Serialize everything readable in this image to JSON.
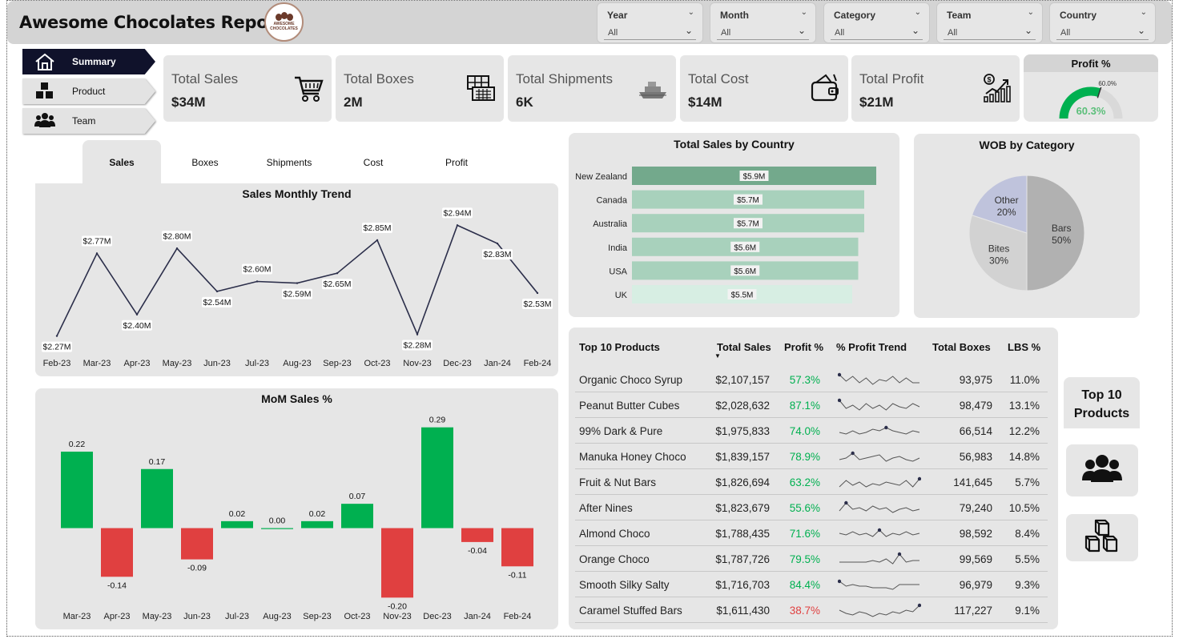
{
  "report": {
    "title": "Awesome Chocolates Report",
    "logo_text": "AWESOME CHOCOLATES"
  },
  "slicers": [
    {
      "label": "Year",
      "value": "All"
    },
    {
      "label": "Month",
      "value": "All"
    },
    {
      "label": "Category",
      "value": "All"
    },
    {
      "label": "Team",
      "value": "All"
    },
    {
      "label": "Country",
      "value": "All"
    }
  ],
  "nav": [
    {
      "label": "Summary",
      "icon": "home-icon",
      "active": true
    },
    {
      "label": "Product",
      "icon": "boxes-icon",
      "active": false
    },
    {
      "label": "Team",
      "icon": "team-icon",
      "active": false
    }
  ],
  "kpis": [
    {
      "title": "Total Sales",
      "value": "$34M",
      "icon": "shopping-cart-icon"
    },
    {
      "title": "Total Boxes",
      "value": "2M",
      "icon": "box-icon"
    },
    {
      "title": "Total Shipments",
      "value": "6K",
      "icon": "ship-icon"
    },
    {
      "title": "Total Cost",
      "value": "$14M",
      "icon": "wallet-icon"
    },
    {
      "title": "Total Profit",
      "value": "$21M",
      "icon": "profit-growth-icon"
    }
  ],
  "profit_gauge": {
    "title": "Profit %",
    "value": 60.3,
    "value_label": "60.3%",
    "target": 60.0,
    "target_label": "60.0%",
    "color": "#00b050"
  },
  "tabs": [
    {
      "label": "Sales",
      "active": true
    },
    {
      "label": "Boxes",
      "active": false
    },
    {
      "label": "Shipments",
      "active": false
    },
    {
      "label": "Cost",
      "active": false
    },
    {
      "label": "Profit",
      "active": false
    }
  ],
  "colors": {
    "positive": "#00b050",
    "negative": "#e04040",
    "line": "#2b2e4a",
    "bar_top": "#73a98c",
    "bar_mid": "#a8d1bc",
    "bar_light": "#d7eee3"
  },
  "chart_data": [
    {
      "id": "sales-monthly-trend",
      "type": "line",
      "title": "Sales Monthly Trend",
      "x": [
        "Feb-23",
        "Mar-23",
        "Apr-23",
        "May-23",
        "Jun-23",
        "Jul-23",
        "Aug-23",
        "Sep-23",
        "Oct-23",
        "Nov-23",
        "Dec-23",
        "Jan-24",
        "Feb-24"
      ],
      "values": [
        2.27,
        2.77,
        2.4,
        2.8,
        2.54,
        2.6,
        2.59,
        2.65,
        2.85,
        2.28,
        2.94,
        2.83,
        2.53
      ],
      "labels": [
        "$2.27M",
        "$2.77M",
        "$2.40M",
        "$2.80M",
        "$2.54M",
        "$2.60M",
        "$2.59M",
        "$2.65M",
        "$2.85M",
        "$2.28M",
        "$2.94M",
        "$2.83M",
        "$2.53M"
      ],
      "ylim": [
        2.2,
        3.0
      ]
    },
    {
      "id": "mom-sales",
      "type": "bar",
      "title": "MoM Sales %",
      "categories": [
        "Mar-23",
        "Apr-23",
        "May-23",
        "Jun-23",
        "Jul-23",
        "Aug-23",
        "Sep-23",
        "Oct-23",
        "Nov-23",
        "Dec-23",
        "Jan-24",
        "Feb-24"
      ],
      "values": [
        0.22,
        -0.14,
        0.17,
        -0.09,
        0.02,
        0.0,
        0.02,
        0.07,
        -0.2,
        0.29,
        -0.04,
        -0.11
      ],
      "labels": [
        "0.22",
        "-0.14",
        "0.17",
        "-0.09",
        "0.02",
        "0.00",
        "0.02",
        "0.07",
        "-0.20",
        "0.29",
        "-0.04",
        "-0.11"
      ],
      "ylim": [
        -0.22,
        0.31
      ]
    },
    {
      "id": "sales-by-country",
      "type": "bar",
      "orientation": "horizontal",
      "title": "Total Sales by Country",
      "categories": [
        "New Zealand",
        "Canada",
        "Australia",
        "India",
        "USA",
        "UK"
      ],
      "values": [
        5.9,
        5.7,
        5.7,
        5.6,
        5.6,
        5.5
      ],
      "labels": [
        "$5.9M",
        "$5.7M",
        "$5.7M",
        "$5.6M",
        "$5.6M",
        "$5.5M"
      ]
    },
    {
      "id": "wob-by-category",
      "type": "pie",
      "title": "WOB by Category",
      "categories": [
        "Bars",
        "Bites",
        "Other"
      ],
      "values": [
        50,
        30,
        20
      ],
      "labels": [
        "50%",
        "30%",
        "20%"
      ],
      "colors": [
        "#b1b1b1",
        "#d2d2d2",
        "#bfc3dc"
      ]
    }
  ],
  "top_products": {
    "headers": [
      "Top 10 Products",
      "Total Sales",
      "Profit %",
      "% Profit Trend",
      "Total Boxes",
      "LBS %"
    ],
    "rows": [
      {
        "product": "Organic Choco Syrup",
        "sales": "$2,107,157",
        "profit": "57.3%",
        "boxes": "93,975",
        "lbs": "11.0%",
        "profit_color": "#00b050",
        "trend": [
          0.8,
          0.4,
          0.7,
          0.3,
          0.6,
          0.2,
          0.5,
          0.4,
          0.7,
          0.3,
          0.6,
          0.3,
          0.3
        ]
      },
      {
        "product": "Peanut Butter Cubes",
        "sales": "$2,028,632",
        "profit": "87.1%",
        "boxes": "98,479",
        "lbs": "13.1%",
        "profit_color": "#00b050",
        "trend": [
          0.8,
          0.3,
          0.5,
          0.2,
          0.6,
          0.3,
          0.5,
          0.2,
          0.6,
          0.4,
          0.3,
          0.6,
          0.4
        ]
      },
      {
        "product": "99% Dark & Pure",
        "sales": "$1,975,833",
        "profit": "74.0%",
        "boxes": "66,514",
        "lbs": "12.2%",
        "profit_color": "#00b050",
        "trend": [
          0.4,
          0.3,
          0.5,
          0.3,
          0.4,
          0.6,
          0.5,
          0.7,
          0.5,
          0.4,
          0.3,
          0.5,
          0.4
        ]
      },
      {
        "product": "Manuka Honey Choco",
        "sales": "$1,839,157",
        "profit": "78.9%",
        "boxes": "56,983",
        "lbs": "14.8%",
        "profit_color": "#00b050",
        "trend": [
          0.3,
          0.4,
          0.7,
          0.3,
          0.4,
          0.5,
          0.6,
          0.2,
          0.4,
          0.5,
          0.3,
          0.2,
          0.4
        ]
      },
      {
        "product": "Fruit & Nut Bars",
        "sales": "$1,826,694",
        "profit": "63.2%",
        "boxes": "141,645",
        "lbs": "5.7%",
        "profit_color": "#00b050",
        "trend": [
          0.2,
          0.6,
          0.3,
          0.5,
          0.2,
          0.4,
          0.3,
          0.5,
          0.4,
          0.3,
          0.6,
          0.2,
          0.7
        ]
      },
      {
        "product": "After Nines",
        "sales": "$1,823,679",
        "profit": "55.6%",
        "boxes": "79,240",
        "lbs": "10.5%",
        "profit_color": "#00b050",
        "trend": [
          0.3,
          0.8,
          0.4,
          0.5,
          0.3,
          0.6,
          0.4,
          0.5,
          0.2,
          0.4,
          0.5,
          0.3,
          0.4
        ]
      },
      {
        "product": "Almond Choco",
        "sales": "$1,788,435",
        "profit": "71.6%",
        "boxes": "98,592",
        "lbs": "8.4%",
        "profit_color": "#00b050",
        "trend": [
          0.5,
          0.4,
          0.6,
          0.4,
          0.5,
          0.3,
          0.7,
          0.3,
          0.5,
          0.4,
          0.6,
          0.4,
          0.5
        ]
      },
      {
        "product": "Orange Choco",
        "sales": "$1,787,726",
        "profit": "79.5%",
        "boxes": "99,569",
        "lbs": "5.5%",
        "profit_color": "#00b050",
        "trend": [
          0.3,
          0.3,
          0.3,
          0.3,
          0.3,
          0.4,
          0.3,
          0.5,
          0.2,
          0.8,
          0.3,
          0.4,
          0.4
        ]
      },
      {
        "product": "Smooth Silky Salty",
        "sales": "$1,716,703",
        "profit": "84.4%",
        "boxes": "96,979",
        "lbs": "9.3%",
        "profit_color": "#00b050",
        "trend": [
          0.7,
          0.4,
          0.5,
          0.4,
          0.4,
          0.3,
          0.3,
          0.3,
          0.2,
          0.5,
          0.5,
          0.5,
          0.5
        ]
      },
      {
        "product": "Caramel Stuffed Bars",
        "sales": "$1,611,430",
        "profit": "38.7%",
        "boxes": "117,227",
        "lbs": "9.1%",
        "profit_color": "#e04040",
        "trend": [
          0.5,
          0.3,
          0.2,
          0.4,
          0.3,
          0.1,
          0.3,
          0.2,
          0.4,
          0.3,
          0.5,
          0.4,
          0.8
        ]
      }
    ]
  },
  "side_panel": {
    "title_line1": "Top 10",
    "title_line2": "Products"
  }
}
